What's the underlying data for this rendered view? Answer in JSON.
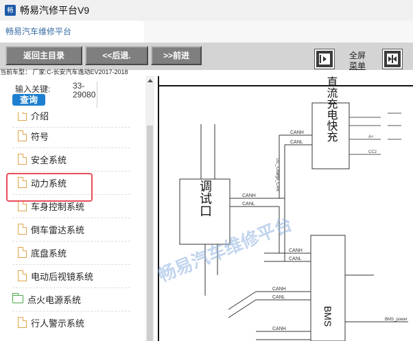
{
  "window": {
    "title": "畅易汽修平台V9",
    "app_icon": "app-logo-icon"
  },
  "tab": {
    "label": "畅易汽车维修平台"
  },
  "toolbar": {
    "back_main": "返回主目录",
    "back": "<<后退.",
    "forward": ">>前进",
    "fullscreen_line1": "全屏",
    "fullscreen_line2": "菜单"
  },
  "vehicle": {
    "info": "当前车型：  厂家:C-长安汽车逸动EV2017-2018"
  },
  "search": {
    "label": "输入关键:",
    "value_line1": "33-",
    "value_line2": "29080",
    "button": "查询"
  },
  "tree": {
    "items": [
      {
        "label": "介绍",
        "icon": "document-icon"
      },
      {
        "label": "符号",
        "icon": "document-icon"
      },
      {
        "label": "安全系统",
        "icon": "document-icon"
      },
      {
        "label": "动力系统",
        "icon": "document-icon",
        "highlighted": true
      },
      {
        "label": "车身控制系统",
        "icon": "document-icon"
      },
      {
        "label": "倒车雷达系统",
        "icon": "document-icon"
      },
      {
        "label": "底盘系统",
        "icon": "document-icon"
      },
      {
        "label": "电动后视镜系统",
        "icon": "document-icon"
      },
      {
        "label": "点火电源系统",
        "icon": "folder-icon"
      },
      {
        "label": "行人警示系统",
        "icon": "document-icon"
      }
    ]
  },
  "diagram": {
    "watermark": "畅易汽车维修平台",
    "module_dc_charge": "直流充电快充",
    "module_gateway": "调试口",
    "module_bms": "BMS",
    "labels": {
      "canh": "CANH",
      "canl": "CANL",
      "a_plus": "A+",
      "cc2": "CC2",
      "bms_power": "BMS_power",
      "charge_can": "DC_Charge_CAN"
    }
  }
}
